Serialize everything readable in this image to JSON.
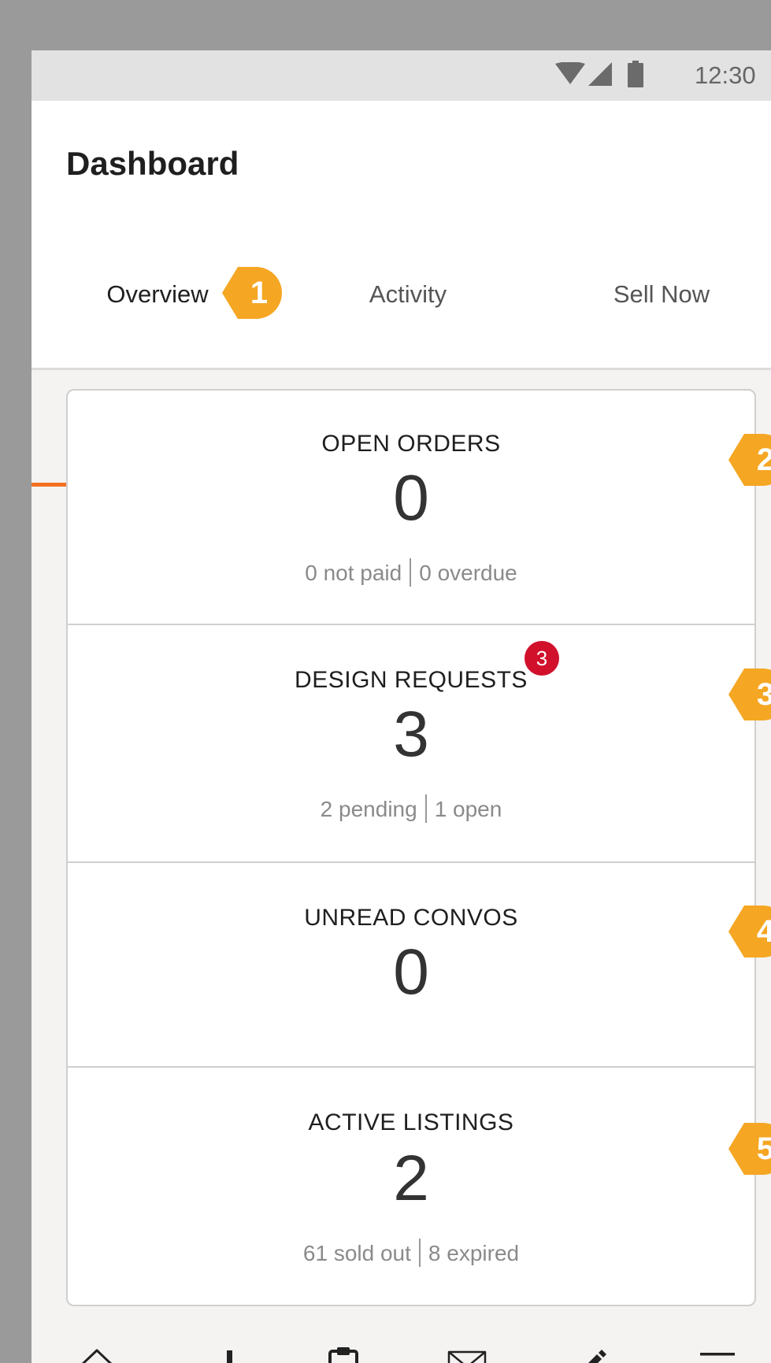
{
  "status_bar": {
    "time": "12:30",
    "icons": [
      "wifi-icon",
      "signal-icon",
      "battery-icon"
    ]
  },
  "header": {
    "title": "Dashboard"
  },
  "tabs": [
    {
      "label": "Overview",
      "active": true
    },
    {
      "label": "Activity",
      "active": false
    },
    {
      "label": "Sell Now",
      "active": false
    }
  ],
  "callouts": [
    "1",
    "2",
    "3",
    "4",
    "5"
  ],
  "cards": [
    {
      "title": "OPEN ORDERS",
      "value": "0",
      "sub_left": "0 not paid",
      "sub_right": "0 overdue",
      "badge": null
    },
    {
      "title": "DESIGN REQUESTS",
      "value": "3",
      "sub_left": "2 pending",
      "sub_right": "1 open",
      "badge": "3"
    },
    {
      "title": "UNREAD CONVOS",
      "value": "0",
      "sub_left": null,
      "sub_right": null,
      "badge": null
    },
    {
      "title": "ACTIVE LISTINGS",
      "value": "2",
      "sub_left": "61 sold out",
      "sub_right": "8 expired",
      "badge": null
    }
  ],
  "bottom_nav": [
    "home-icon",
    "stats-icon",
    "clipboard-icon",
    "mail-icon",
    "edit-icon",
    "menu-icon"
  ],
  "colors": {
    "accent": "#f37021",
    "callout": "#f5a623",
    "badge": "#d1102c"
  }
}
